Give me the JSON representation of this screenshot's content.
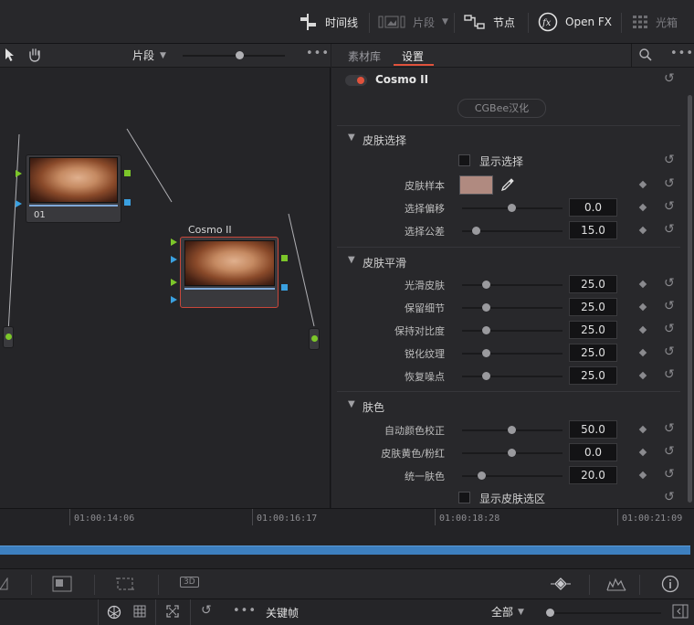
{
  "topbar": {
    "timeline_label": "时间线",
    "clips_label": "片段",
    "nodes_label": "节点",
    "openfx_label": "Open FX",
    "lightbox_label": "光箱"
  },
  "node_editor": {
    "clip_dropdown": "片段",
    "node1_label": "01",
    "node2_label": "Cosmo II"
  },
  "inspector": {
    "tabs": [
      "素材库",
      "设置"
    ],
    "active_tab": "设置",
    "effect_name": "Cosmo II",
    "badge": "CGBee汉化",
    "sections": {
      "skin_select": "皮肤选择",
      "skin_smooth": "皮肤平滑",
      "skin_tone": "肤色"
    },
    "show_selection": "显示选择",
    "skin_sample": "皮肤样本",
    "skin_sample_color": "#b08a80",
    "params": {
      "select_offset": {
        "label": "选择偏移",
        "value": "0.0",
        "fraction": 0.5
      },
      "select_tolerance": {
        "label": "选择公差",
        "value": "15.0",
        "fraction": 0.15
      },
      "smooth_skin": {
        "label": "光滑皮肤",
        "value": "25.0",
        "fraction": 0.25
      },
      "keep_detail": {
        "label": "保留细节",
        "value": "25.0",
        "fraction": 0.25
      },
      "keep_contrast": {
        "label": "保持对比度",
        "value": "25.0",
        "fraction": 0.25
      },
      "sharpen_texture": {
        "label": "锐化纹理",
        "value": "25.0",
        "fraction": 0.25
      },
      "restore_noise": {
        "label": "恢复噪点",
        "value": "25.0",
        "fraction": 0.25
      },
      "auto_color": {
        "label": "自动颜色校正",
        "value": "50.0",
        "fraction": 0.5
      },
      "skin_yellow_pink": {
        "label": "皮肤黄色/粉红",
        "value": "0.0",
        "fraction": 0.5
      },
      "unify_skin": {
        "label": "统一肤色",
        "value": "20.0",
        "fraction": 0.2
      }
    },
    "show_skin_region": "显示皮肤选区"
  },
  "timeline": {
    "timecodes": [
      "01:00:14:06",
      "01:00:16:17",
      "01:00:18:28",
      "01:00:21:09"
    ]
  },
  "keyframe_bar": {
    "label": "关键帧",
    "filter": "全部"
  },
  "colors": {
    "accent": "#e0523c",
    "node_selected_border": "#c8463a",
    "track": "#3d7fbf",
    "port_green": "#7cc62a",
    "port_blue": "#3aa0e0"
  }
}
